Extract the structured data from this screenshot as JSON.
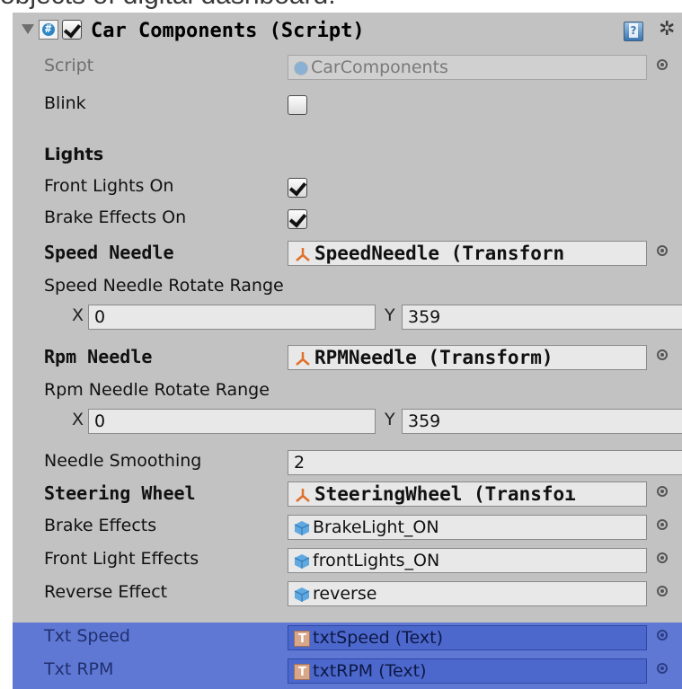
{
  "caption": "objects of digital dashboard.",
  "header": {
    "title": "Car Components (Script)",
    "enabled": true
  },
  "rows": {
    "script": {
      "label": "Script",
      "value": "CarComponents"
    },
    "blink": {
      "label": "Blink",
      "checked": false
    },
    "lights_header": {
      "label": "Lights"
    },
    "front_lights_on": {
      "label": "Front Lights On",
      "checked": true
    },
    "brake_effects_on": {
      "label": "Brake Effects On",
      "checked": true
    },
    "speed_needle": {
      "label": "Speed Needle",
      "value": "SpeedNeedle (Transforn"
    },
    "speed_range": {
      "label": "Speed Needle Rotate Range",
      "x_label": "X",
      "x": "0",
      "y_label": "Y",
      "y": "359"
    },
    "rpm_needle": {
      "label": "Rpm Needle",
      "value": "RPMNeedle (Transform)"
    },
    "rpm_range": {
      "label": "Rpm Needle Rotate Range",
      "x_label": "X",
      "x": "0",
      "y_label": "Y",
      "y": "359"
    },
    "needle_smoothing": {
      "label": "Needle Smoothing",
      "value": "2"
    },
    "steering_wheel": {
      "label": "Steering Wheel",
      "value": "SteeringWheel (Transfoı"
    },
    "brake_effects": {
      "label": "Brake Effects",
      "value": "BrakeLight_ON"
    },
    "front_light_effects": {
      "label": "Front Light Effects",
      "value": "frontLights_ON"
    },
    "reverse_effect": {
      "label": "Reverse Effect",
      "value": "reverse"
    },
    "txt_speed": {
      "label": "Txt Speed",
      "value": "txtSpeed (Text)"
    },
    "txt_rpm": {
      "label": "Txt RPM",
      "value": "txtRPM (Text)"
    }
  },
  "colors": {
    "panel_bg": "#c2c2c2",
    "selection": "#5f78d3",
    "field_bg": "#e8e8e8"
  }
}
